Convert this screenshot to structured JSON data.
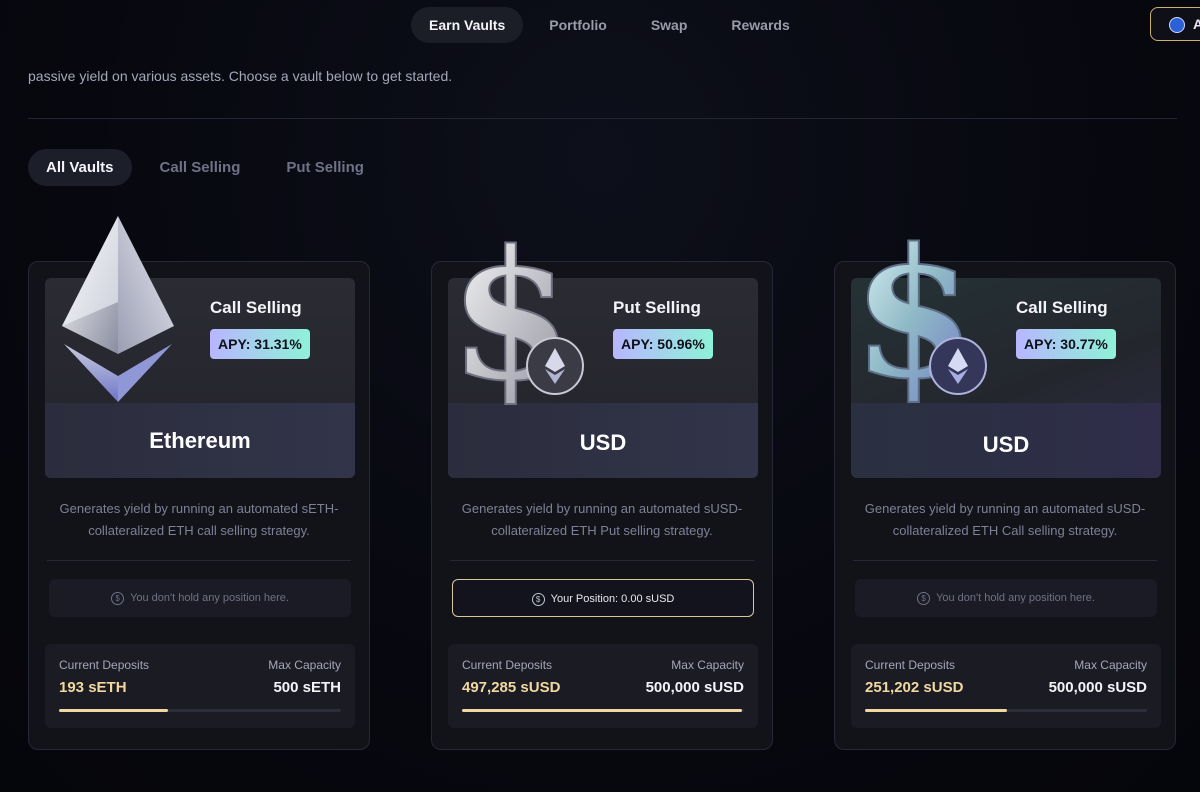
{
  "nav": {
    "items": [
      "Earn Vaults",
      "Portfolio",
      "Swap",
      "Rewards"
    ],
    "active": "Earn Vaults",
    "wallet_label": "A"
  },
  "intro_text": "passive yield on various assets. Choose a vault below to get started.",
  "filters": {
    "tabs": [
      "All Vaults",
      "Call Selling",
      "Put Selling"
    ],
    "active": "All Vaults"
  },
  "vaults": [
    {
      "type": "Call Selling",
      "apy": "APY: 31.31%",
      "asset": "Ethereum",
      "icon": "ethereum-3d-icon",
      "description": "Generates yield by running an automated sETH-collateralized ETH call selling strategy.",
      "position": "You don't hold any position here.",
      "deposits_label": "Current Deposits",
      "deposits": "193 sETH",
      "capacity_label": "Max Capacity",
      "capacity": "500 sETH",
      "fill_fraction": 0.386
    },
    {
      "type": "Put Selling",
      "apy": "APY: 50.96%",
      "asset": "USD",
      "icon": "dollar-3d-icon",
      "description": "Generates yield by running an automated sUSD-collateralized ETH Put selling strategy.",
      "position": "Your Position: 0.00 sUSD",
      "deposits_label": "Current Deposits",
      "deposits": "497,285 sUSD",
      "capacity_label": "Max Capacity",
      "capacity": "500,000 sUSD",
      "fill_fraction": 0.9946
    },
    {
      "type": "Call Selling",
      "apy": "APY: 30.77%",
      "asset": "USD",
      "icon": "dollar-3d-icon",
      "description": "Generates yield by running an automated sUSD-collateralized ETH Call selling strategy.",
      "position": "You don't hold any position here.",
      "deposits_label": "Current Deposits",
      "deposits": "251,202 sUSD",
      "capacity_label": "Max Capacity",
      "capacity": "500,000 sUSD",
      "fill_fraction": 0.5024
    }
  ],
  "colors": {
    "accent_gold": "#f0d8a0",
    "apy_start": "#b8b6ff",
    "apy_end": "#8ef2d8"
  }
}
